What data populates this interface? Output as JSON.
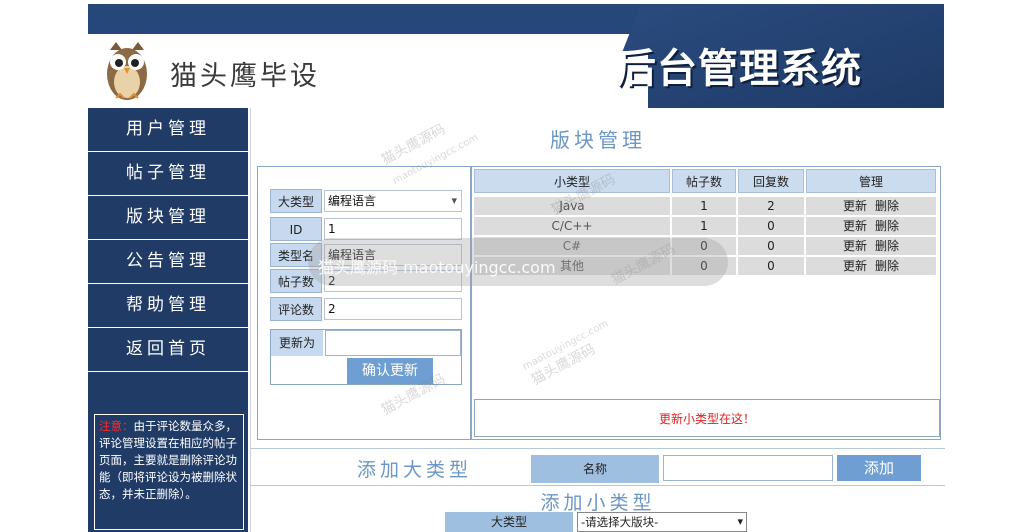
{
  "header": {
    "site_name": "猫头鹰毕设",
    "system_title": "后台管理系统"
  },
  "sidebar": {
    "items": [
      {
        "label": "用户管理"
      },
      {
        "label": "帖子管理"
      },
      {
        "label": "版块管理"
      },
      {
        "label": "公告管理"
      },
      {
        "label": "帮助管理"
      },
      {
        "label": "返回首页"
      }
    ],
    "notice_prefix": "注意：",
    "notice_text": "由于评论数量众多，评论管理设置在相应的帖子页面，主要就是删除评论功能（即将评论设为被删除状态，并未正删除）。"
  },
  "main": {
    "title": "版块管理",
    "form": {
      "major_label": "大类型",
      "major_value": "编程语言",
      "id_label": "ID",
      "id_value": "1",
      "type_name_label": "类型名",
      "type_name_value": "编程语言",
      "post_count_label": "帖子数",
      "post_count_value": "2",
      "comment_count_label": "评论数",
      "comment_count_value": "2",
      "update_to_label": "更新为",
      "confirm_label": "确认更新"
    },
    "table": {
      "headers": [
        "小类型",
        "帖子数",
        "回复数",
        "管理"
      ],
      "rows": [
        {
          "type": "Java",
          "posts": "1",
          "replies": "2"
        },
        {
          "type": "C/C++",
          "posts": "1",
          "replies": "0"
        },
        {
          "type": "C#",
          "posts": "0",
          "replies": "0"
        },
        {
          "type": "其他",
          "posts": "0",
          "replies": "0"
        }
      ],
      "update_action": "更新",
      "delete_action": "删除",
      "update_note": "更新小类型在这！"
    },
    "add_major": {
      "title": "添加大类型",
      "name_label": "名称",
      "add_button": "添加"
    },
    "add_minor": {
      "title": "添加小类型",
      "major_label": "大类型",
      "select_placeholder": "-请选择大版块-"
    }
  },
  "watermark": {
    "text": "猫头鹰源码",
    "url": "maotouyingcc.com",
    "bar_text": "猫头鹰源码 maotouyingcc.com"
  }
}
